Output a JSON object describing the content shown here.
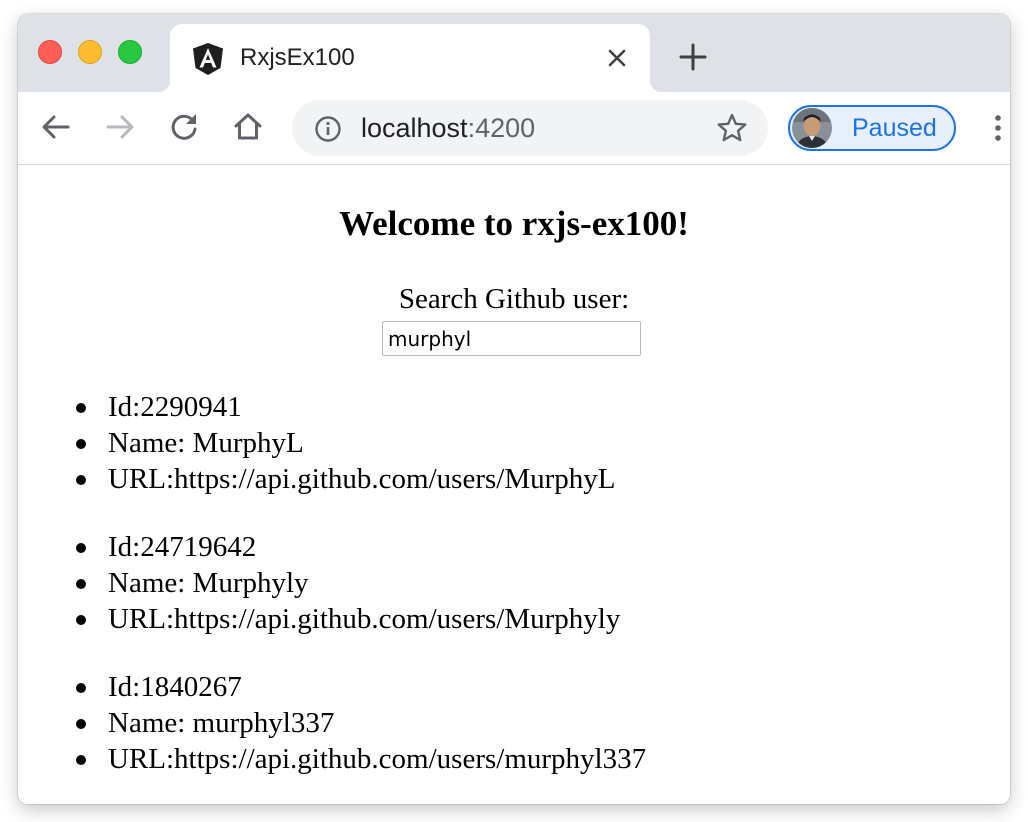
{
  "browser": {
    "tab": {
      "title": "RxjsEx100",
      "favicon": "angular-logo-icon"
    },
    "toolbar": {
      "url_host": "localhost",
      "url_port": ":4200",
      "profile_status": "Paused",
      "icons": [
        "back-arrow-icon",
        "forward-arrow-icon",
        "reload-icon",
        "home-icon",
        "info-icon",
        "star-icon",
        "kebab-menu-icon"
      ]
    },
    "colors": {
      "tabstrip": "#dee1e6",
      "omnibox": "#f1f3f4",
      "profile_accent": "#1a73e8",
      "close_red": "#ff5f57",
      "minimize_yellow": "#febc2e",
      "zoom_green": "#28c840"
    }
  },
  "page": {
    "title": "Welcome to rxjs-ex100!",
    "search_label": "Search Github user:",
    "search_value": "murphyl",
    "results": [
      {
        "id": "Id:2290941",
        "name": "Name: MurphyL",
        "url": "URL:https://api.github.com/users/MurphyL"
      },
      {
        "id": "Id:24719642",
        "name": "Name: Murphyly",
        "url": "URL:https://api.github.com/users/Murphyly"
      },
      {
        "id": "Id:1840267",
        "name": "Name: murphyl337",
        "url": "URL:https://api.github.com/users/murphyl337"
      }
    ]
  }
}
